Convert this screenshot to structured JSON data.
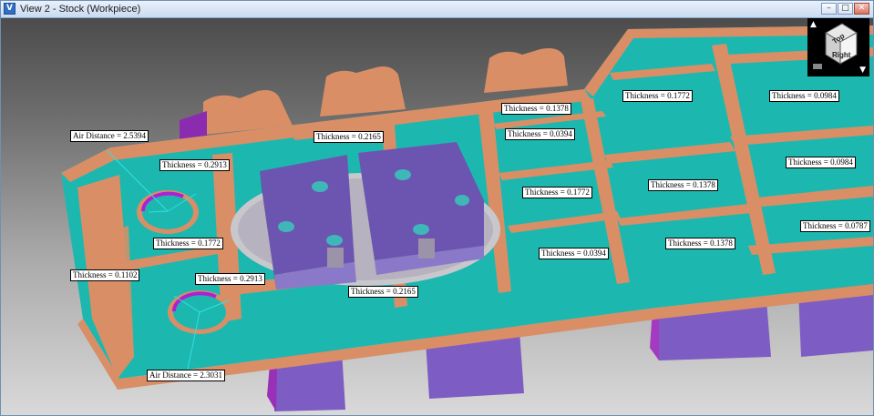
{
  "window": {
    "title": "View 2 - Stock (Workpiece)",
    "controls": {
      "minimize": "–",
      "restore": "□",
      "close": "✕"
    }
  },
  "view_cube": {
    "top_label": "Top",
    "right_label": "Right",
    "up_arrow": "▲",
    "down_arrow": "▼"
  },
  "annotations": [
    {
      "id": "air1",
      "text": "Air Distance = 2.5394"
    },
    {
      "id": "t1",
      "text": "Thickness = 0.2913"
    },
    {
      "id": "t2",
      "text": "Thickness = 0.2165"
    },
    {
      "id": "t3",
      "text": "Thickness = 0.1378"
    },
    {
      "id": "t4",
      "text": "Thickness = 0.0394"
    },
    {
      "id": "t5",
      "text": "Thickness = 0.1772"
    },
    {
      "id": "t6",
      "text": "Thickness = 0.0984"
    },
    {
      "id": "t7",
      "text": "Thickness = 0.1772"
    },
    {
      "id": "t8",
      "text": "Thickness = 0.1772"
    },
    {
      "id": "t9",
      "text": "Thickness = 0.1378"
    },
    {
      "id": "t10",
      "text": "Thickness = 0.0984"
    },
    {
      "id": "t11",
      "text": "Thickness = 0.1102"
    },
    {
      "id": "t12",
      "text": "Thickness = 0.2913"
    },
    {
      "id": "t13",
      "text": "Thickness = 0.0394"
    },
    {
      "id": "t14",
      "text": "Thickness = 0.1378"
    },
    {
      "id": "t15",
      "text": "Thickness = 0.0787"
    },
    {
      "id": "t16",
      "text": "Thickness = 0.2165"
    },
    {
      "id": "air2",
      "text": "Air Distance = 2.3031"
    }
  ],
  "colors": {
    "stock_copper": "#d98e66",
    "pocket_teal": "#1cb8b0",
    "fixture_purple": "#7b62b8",
    "clamp_purple": "#7d5cc4",
    "background_top": "#4c4c4c",
    "background_bottom": "#d9d9d9"
  }
}
